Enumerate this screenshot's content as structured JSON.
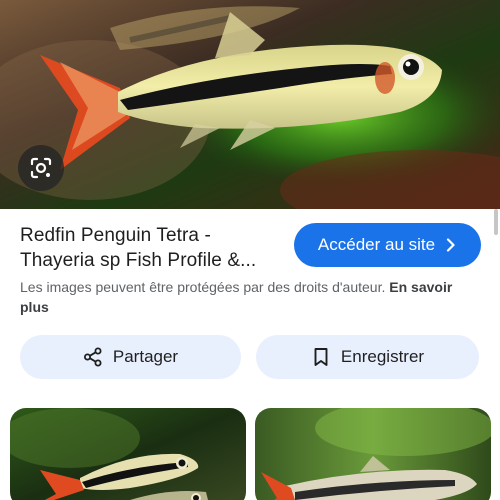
{
  "result": {
    "title": "Redfin Penguin Tetra - Thayeria sp Fish Profile &...",
    "visit_label": "Accéder au site",
    "copyright_text": "Les images peuvent être protégées par des droits d'auteur.",
    "learn_more_label": "En savoir plus"
  },
  "actions": {
    "share_label": "Partager",
    "save_label": "Enregistrer"
  },
  "colors": {
    "accent": "#1a73e8",
    "button_tint": "#e8f0fe"
  },
  "icons": {
    "lens": "google-lens-icon",
    "chevron": "chevron-right-icon",
    "share": "share-icon",
    "bookmark": "bookmark-icon"
  }
}
